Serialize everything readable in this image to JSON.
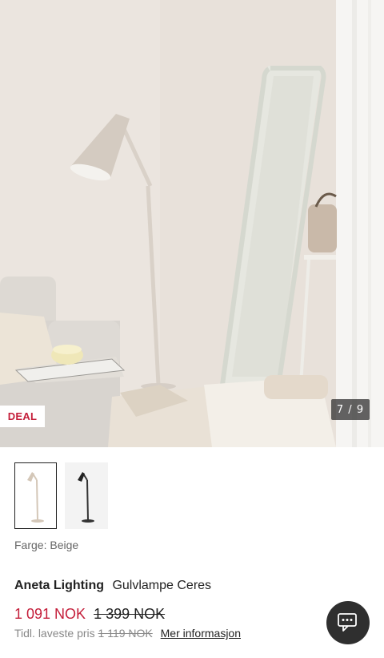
{
  "gallery": {
    "badge": "DEAL",
    "counter": "7 / 9",
    "colors": {
      "accent": "#c41e3a",
      "counter_bg": "#333333"
    }
  },
  "variants": {
    "items": [
      {
        "name": "Beige",
        "selected": true
      },
      {
        "name": "Black",
        "selected": false
      }
    ]
  },
  "color": {
    "label": "Farge: Beige"
  },
  "product": {
    "brand": "Aneta Lighting",
    "name": "Gulvlampe Ceres"
  },
  "price": {
    "current": "1 091 NOK",
    "original": "1 399 NOK",
    "prev_lowest_label": "Tidl. laveste pris",
    "prev_lowest_value": "1 119 NOK",
    "more_info": "Mer informasjon"
  },
  "chat": {
    "icon": "chat-icon"
  }
}
